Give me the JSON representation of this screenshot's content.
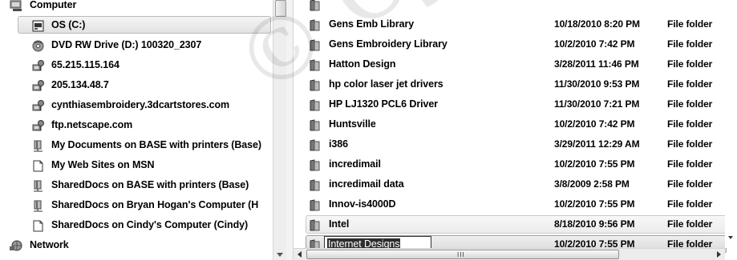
{
  "nav": {
    "items": [
      {
        "label": "Computer",
        "icon": "computer-icon",
        "indent": 0,
        "selected": false
      },
      {
        "label": "OS (C:)",
        "icon": "drive-icon",
        "indent": 1,
        "selected": true
      },
      {
        "label": "DVD RW Drive (D:) 100320_2307",
        "icon": "dvd-drive-icon",
        "indent": 1,
        "selected": false
      },
      {
        "label": "65.215.115.164",
        "icon": "network-location-icon",
        "indent": 1,
        "selected": false
      },
      {
        "label": "205.134.48.7",
        "icon": "network-location-icon",
        "indent": 1,
        "selected": false
      },
      {
        "label": "cynthiasembroidery.3dcartstores.com",
        "icon": "network-location-icon",
        "indent": 1,
        "selected": false
      },
      {
        "label": "ftp.netscape.com",
        "icon": "network-location-icon",
        "indent": 1,
        "selected": false
      },
      {
        "label": "My Documents on BASE with printers (Base)",
        "icon": "network-share-icon",
        "indent": 1,
        "selected": false
      },
      {
        "label": "My Web Sites on MSN",
        "icon": "document-icon",
        "indent": 1,
        "selected": false
      },
      {
        "label": "SharedDocs on BASE with printers (Base)",
        "icon": "network-share-icon",
        "indent": 1,
        "selected": false
      },
      {
        "label": "SharedDocs on Bryan Hogan's Computer (H",
        "icon": "network-share-icon",
        "indent": 1,
        "selected": false
      },
      {
        "label": "SharedDocs on Cindy's Computer (Cindy)",
        "icon": "document-icon",
        "indent": 1,
        "selected": false
      },
      {
        "label": "Network",
        "icon": "network-icon",
        "indent": 0,
        "selected": false
      }
    ]
  },
  "files": {
    "rows": [
      {
        "name": "",
        "date": "",
        "type": "",
        "state": "partial"
      },
      {
        "name": "Gens Emb Library",
        "date": "10/18/2010 8:20 PM",
        "type": "File folder",
        "state": "normal"
      },
      {
        "name": "Gens Embroidery Library",
        "date": "10/2/2010 7:42 PM",
        "type": "File folder",
        "state": "normal"
      },
      {
        "name": "Hatton Design",
        "date": "3/28/2011 11:46 PM",
        "type": "File folder",
        "state": "normal"
      },
      {
        "name": "hp color laser jet drivers",
        "date": "11/30/2010 9:53 PM",
        "type": "File folder",
        "state": "normal"
      },
      {
        "name": "HP LJ1320 PCL6 Driver",
        "date": "11/30/2010 7:21 PM",
        "type": "File folder",
        "state": "normal"
      },
      {
        "name": "Huntsville",
        "date": "10/2/2010 7:42 PM",
        "type": "File folder",
        "state": "normal"
      },
      {
        "name": "i386",
        "date": "3/29/2011 12:29 AM",
        "type": "File folder",
        "state": "normal"
      },
      {
        "name": "incredimail",
        "date": "10/2/2010 7:55 PM",
        "type": "File folder",
        "state": "normal"
      },
      {
        "name": "incredimail data",
        "date": "3/8/2009 2:58 PM",
        "type": "File folder",
        "state": "normal"
      },
      {
        "name": "Innov-is4000D",
        "date": "10/2/2010 7:55 PM",
        "type": "File folder",
        "state": "normal"
      },
      {
        "name": "Intel",
        "date": "8/18/2010 9:56 PM",
        "type": "File folder",
        "state": "hover"
      },
      {
        "name": "Internet Designs",
        "date": "10/2/2010 7:55 PM",
        "type": "File folder",
        "state": "renaming"
      }
    ]
  },
  "hscroll": {
    "grip": "III"
  },
  "watermark": {
    "text": "© Cynthia's E"
  }
}
